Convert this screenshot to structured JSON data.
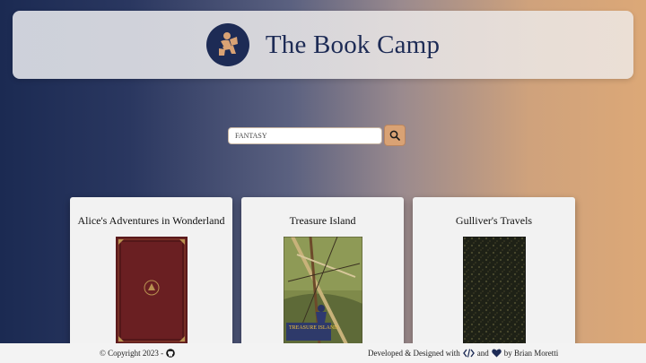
{
  "header": {
    "title": "The Book Camp",
    "logo_icon": "reading-person-icon"
  },
  "search": {
    "value": "FANTASY",
    "button_icon": "search-icon"
  },
  "books": [
    {
      "title": "Alice's Adventures in Wonderland",
      "cover": "dark-red-leather-cover"
    },
    {
      "title": "Treasure Island",
      "cover": "illustrated-ship-mast-cover",
      "cover_text": "TREASURE ISLAND"
    },
    {
      "title": "Gulliver's Travels",
      "cover": "dark-marbled-cover"
    }
  ],
  "footer": {
    "copyright": "© Copyright 2023 -",
    "copyright_icon": "github-icon",
    "credit_prefix": "Developed & Designed with",
    "code_icon": "code-icon",
    "credit_and": "and",
    "heart_icon": "heart-icon",
    "credit_suffix": "by Brian Moretti"
  },
  "colors": {
    "navy": "#1d2b55",
    "accent": "#d9a274",
    "card_bg": "#f2f2f2"
  }
}
